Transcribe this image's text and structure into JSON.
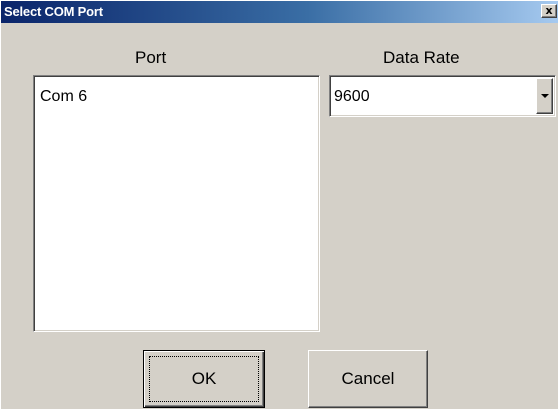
{
  "window": {
    "title": "Select COM Port",
    "close_label": "x"
  },
  "port": {
    "label": "Port",
    "items": [
      "Com 6"
    ]
  },
  "data_rate": {
    "label": "Data Rate",
    "selected": "9600"
  },
  "buttons": {
    "ok_label": "OK",
    "cancel_label": "Cancel"
  },
  "colors": {
    "face": "#d4d0c8",
    "title_start": "#0a246a",
    "title_end": "#a6caf0"
  },
  "icons": {
    "close": "close-icon",
    "dropdown": "chevron-down-icon"
  }
}
